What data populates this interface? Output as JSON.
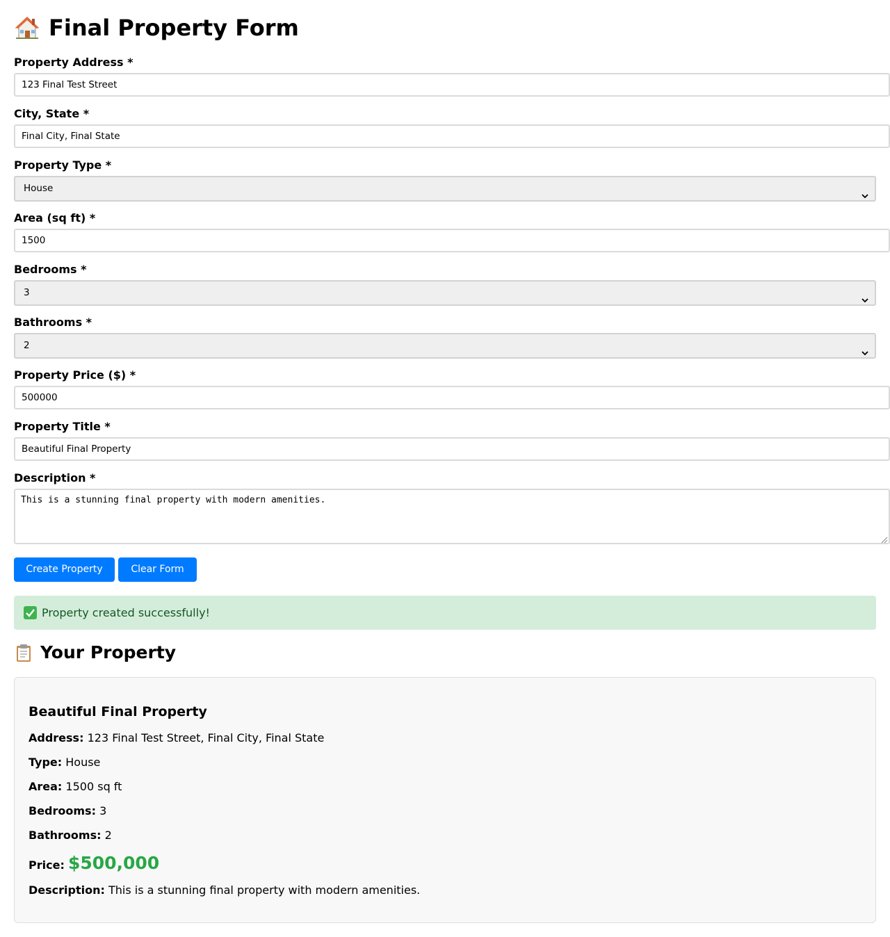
{
  "header": {
    "title": "Final Property Form"
  },
  "form": {
    "address": {
      "label": "Property Address *",
      "value": "123 Final Test Street"
    },
    "city_state": {
      "label": "City, State *",
      "value": "Final City, Final State"
    },
    "property_type": {
      "label": "Property Type *",
      "value": "House"
    },
    "area": {
      "label": "Area (sq ft) *",
      "value": "1500"
    },
    "bedrooms": {
      "label": "Bedrooms *",
      "value": "3"
    },
    "bathrooms": {
      "label": "Bathrooms *",
      "value": "2"
    },
    "price": {
      "label": "Property Price ($) *",
      "value": "500000"
    },
    "title": {
      "label": "Property Title *",
      "value": "Beautiful Final Property"
    },
    "description": {
      "label": "Description *",
      "value": "This is a stunning final property with modern amenities."
    },
    "create_button": "Create Property",
    "clear_button": "Clear Form"
  },
  "alert": {
    "message": "Property created successfully!",
    "color": "#155724",
    "background": "#d4edda"
  },
  "result": {
    "heading": "Your Property",
    "title": "Beautiful Final Property",
    "address_label": "Address:",
    "address_value": "123 Final Test Street, Final City, Final State",
    "type_label": "Type:",
    "type_value": "House",
    "area_label": "Area:",
    "area_value": "1500 sq ft",
    "bedrooms_label": "Bedrooms:",
    "bedrooms_value": "3",
    "bathrooms_label": "Bathrooms:",
    "bathrooms_value": "2",
    "price_label": "Price:",
    "price_value": "$500,000",
    "description_label": "Description:",
    "description_value": "This is a stunning final property with modern amenities."
  },
  "colors": {
    "primary_button": "#007bff",
    "price": "#28a745"
  },
  "icons": {
    "title_icon": "house-icon",
    "heading_icon": "clipboard-icon",
    "alert_icon": "check-icon"
  }
}
